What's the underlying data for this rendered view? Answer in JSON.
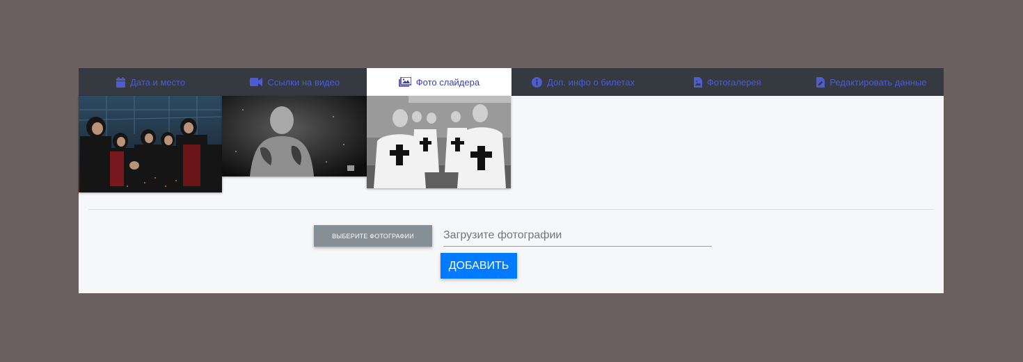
{
  "tabs": [
    {
      "label": "Дата и место",
      "icon": "calendar-icon",
      "active": false
    },
    {
      "label": "Ссылки на видео",
      "icon": "video-camera-icon",
      "active": false
    },
    {
      "label": "Фото слайдера",
      "icon": "images-icon",
      "active": true
    },
    {
      "label": "Доп. инфо о билетах",
      "icon": "info-circle-icon",
      "active": false
    },
    {
      "label": "Фотогалерея",
      "icon": "image-file-icon",
      "active": false
    },
    {
      "label": "Редактировать данные",
      "icon": "edit-file-icon",
      "active": false
    }
  ],
  "slider_photos": [
    {
      "name": "slider-photo-1",
      "description": "band group photo, dark blue industrial background"
    },
    {
      "name": "slider-photo-2",
      "description": "black and white portrait of tattooed man"
    },
    {
      "name": "slider-photo-3",
      "description": "black and white group photo in white t-shirts with crosses"
    }
  ],
  "upload": {
    "choose_label": "ВЫБЕРИТЕ ФОТОГРАФИИ",
    "placeholder": "Загрузите фотографии",
    "value": "",
    "add_label": "ДОБАВИТЬ"
  },
  "colors": {
    "background": "#6b6060",
    "tab_bar": "#343a40",
    "tab_text": "#4f5bd0",
    "panel": "#f6f7f9",
    "choose_button": "#868e96",
    "add_button": "#007bff"
  }
}
